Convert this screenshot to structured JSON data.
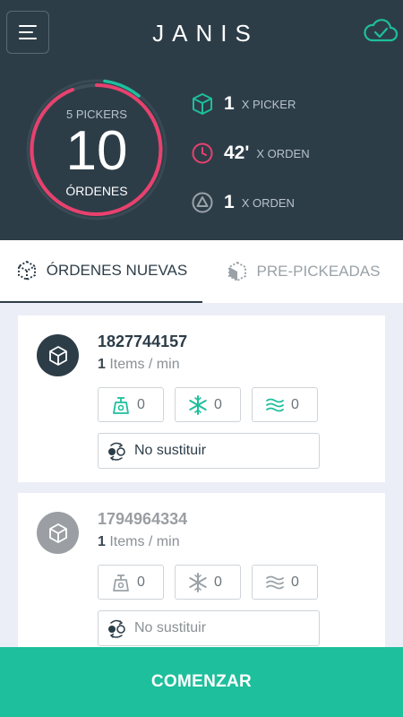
{
  "header": {
    "title": "JANIS"
  },
  "stats": {
    "pickers_label": "5 PICKERS",
    "orders_count": "10",
    "orders_label": "ÓRDENES",
    "items": [
      {
        "value": "1",
        "unit": "X PICKER",
        "icon": "box-icon",
        "color": "#1dbf9c"
      },
      {
        "value": "42'",
        "unit": "X ORDEN",
        "icon": "clock-icon",
        "color": "#e8416e"
      },
      {
        "value": "1",
        "unit": "X ORDEN",
        "icon": "triangle-icon",
        "color": "#9aa2a8"
      }
    ]
  },
  "tabs": [
    {
      "label": "ÓRDENES NUEVAS",
      "active": true
    },
    {
      "label": "PRE-PICKEADAS",
      "active": false
    }
  ],
  "orders": [
    {
      "number": "1827744157",
      "items_count": "1",
      "items_label": " Items /  min",
      "weight": "0",
      "frozen": "0",
      "refrigerated": "0",
      "substitution": "No sustituir"
    },
    {
      "number": "1794964334",
      "items_count": "1",
      "items_label": " Items /  min",
      "weight": "0",
      "frozen": "0",
      "refrigerated": "0",
      "substitution": "No sustituir"
    }
  ],
  "footer": {
    "start_label": "COMENZAR"
  },
  "colors": {
    "dark": "#2d3d48",
    "accent": "#1dbf9c",
    "pink": "#e8416e"
  }
}
